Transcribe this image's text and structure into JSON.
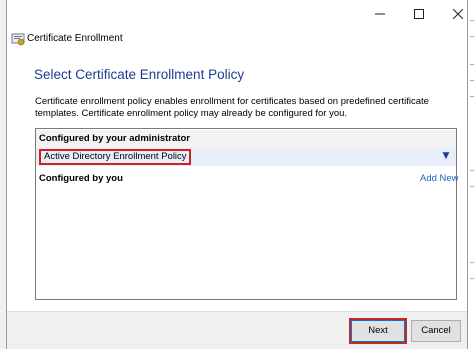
{
  "window": {
    "controls": {
      "minimize": "—",
      "maximize": "☐",
      "close": "✕"
    }
  },
  "header": {
    "title": "Certificate Enrollment"
  },
  "page": {
    "heading": "Select Certificate Enrollment Policy",
    "description": "Certificate enrollment policy enables enrollment for certificates based on predefined certificate templates. Certificate enrollment policy may already be configured for you."
  },
  "policy_list": {
    "admin_section": "Configured by your administrator",
    "admin_items": [
      "Active Directory Enrollment Policy"
    ],
    "user_section": "Configured by you",
    "add_new": "Add New"
  },
  "footer": {
    "next_label": "Next",
    "cancel_label": "Cancel"
  },
  "icons": {
    "back": "back-arrow-icon",
    "expand": "chevron-down-icon"
  },
  "colors": {
    "heading": "#1e3d8f",
    "link": "#1e63b7",
    "highlight": "#d22020"
  }
}
